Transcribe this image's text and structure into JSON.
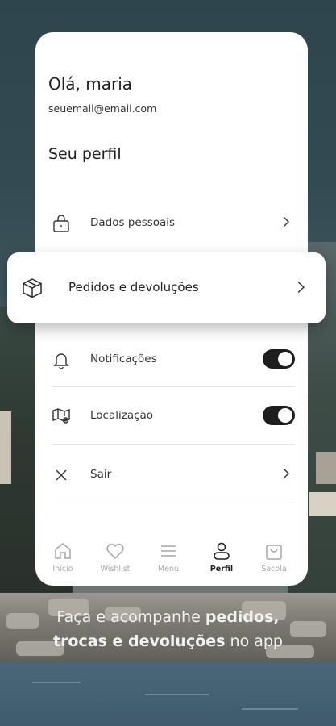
{
  "profile": {
    "greeting": "Olá, maria",
    "email": "seuemail@email.com",
    "section_title": "Seu perfil"
  },
  "menu": {
    "dados_pessoais": "Dados pessoais",
    "pedidos": "Pedidos e devoluções",
    "notificacoes": "Notificações",
    "localizacao": "Localização",
    "sair": "Sair"
  },
  "toggles": {
    "notificacoes_on": true,
    "localizacao_on": true
  },
  "tabbar": {
    "inicio": "Início",
    "wishlist": "Wishlist",
    "menu": "Menu",
    "perfil": "Perfil",
    "sacola": "Sacola",
    "active": "perfil"
  },
  "promo": {
    "part1": "Faça e acompanhe ",
    "part2": "pedidos,",
    "part3": "trocas e devoluções",
    "part4": " no app"
  },
  "colors": {
    "toggle_on": "#1e1e1e",
    "tab_inactive": "#a6a6a6",
    "tab_active": "#1f1f1f"
  }
}
